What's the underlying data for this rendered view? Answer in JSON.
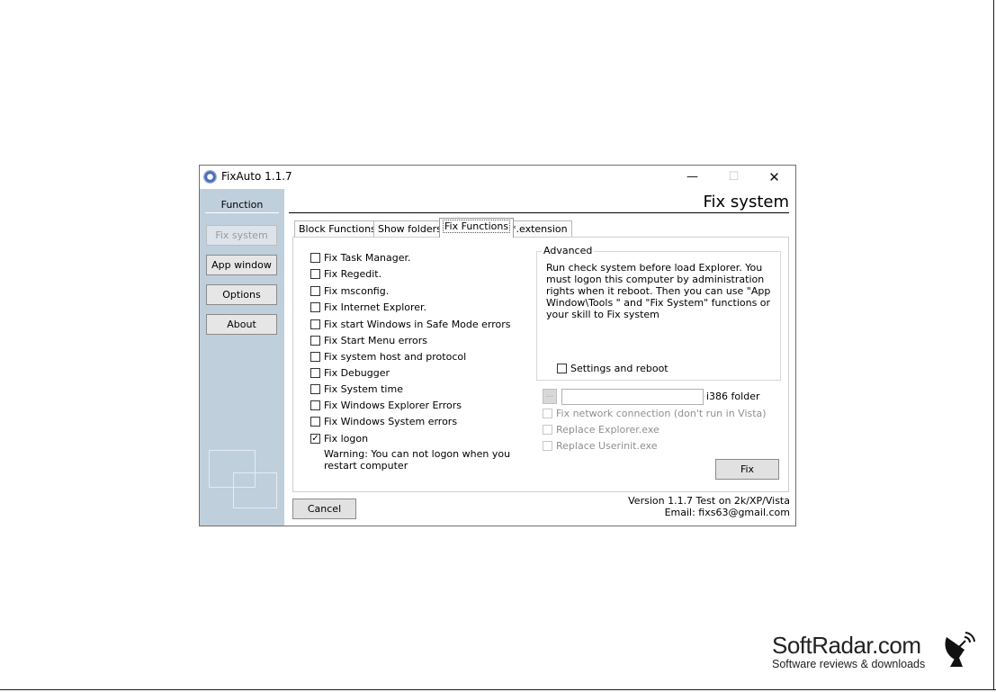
{
  "window": {
    "title": "FixAuto 1.1.7",
    "controls": {
      "minimize": "—",
      "maximize": "☐",
      "close": "✕"
    }
  },
  "sidebar": {
    "heading": "Function",
    "buttons": [
      {
        "label": "Fix system",
        "enabled": false
      },
      {
        "label": "App window",
        "enabled": true
      },
      {
        "label": "Options",
        "enabled": true
      },
      {
        "label": "About",
        "enabled": true
      }
    ]
  },
  "header": {
    "title": "Fix system"
  },
  "tabs": [
    {
      "label": "Block Functions",
      "active": false
    },
    {
      "label": "Show folders",
      "active": false
    },
    {
      "label": "Fix Functions",
      "active": true
    },
    {
      "label": "*.extension",
      "active": false
    }
  ],
  "fix_options": [
    {
      "label": "Fix Task Manager.",
      "checked": false
    },
    {
      "label": "Fix Regedit.",
      "checked": false
    },
    {
      "label": "Fix msconfig.",
      "checked": false
    },
    {
      "label": "Fix Internet Explorer.",
      "checked": false
    },
    {
      "label": "Fix start Windows in Safe Mode errors",
      "checked": false
    },
    {
      "label": "Fix Start Menu errors",
      "checked": false
    },
    {
      "label": "Fix system host and protocol",
      "checked": false
    },
    {
      "label": "Fix Debugger",
      "checked": false
    },
    {
      "label": "Fix System time",
      "checked": false
    },
    {
      "label": "Fix Windows Explorer Errors",
      "checked": false
    },
    {
      "label": "Fix Windows System errors",
      "checked": false
    },
    {
      "label": "Fix logon",
      "checked": true
    }
  ],
  "logon_warning": "Warning: You can not logon when you restart computer",
  "advanced": {
    "legend": "Advanced",
    "description": "Run check system before load Explorer. You must logon this computer by administration rights when it reboot. Then you can use \"App Window\\Tools \" and \"Fix System\" functions or your skill to Fix system",
    "settings_checkbox": {
      "label": "Settings and reboot",
      "checked": false
    }
  },
  "folder": {
    "browse_label": "...",
    "value": "",
    "label": "i386 folder"
  },
  "disabled_options": [
    {
      "label": "Fix network connection (don't run in Vista)",
      "checked": false
    },
    {
      "label": "Replace Explorer.exe",
      "checked": false
    },
    {
      "label": "Replace Userinit.exe",
      "checked": false
    }
  ],
  "buttons": {
    "fix": "Fix",
    "cancel": "Cancel"
  },
  "footer": {
    "version": "Version 1.1.7 Test on 2k/XP/Vista",
    "email": "Email: fixs63@gmail.com"
  },
  "watermark": {
    "name": "SoftRadar.com",
    "tagline": "Software reviews & downloads"
  }
}
